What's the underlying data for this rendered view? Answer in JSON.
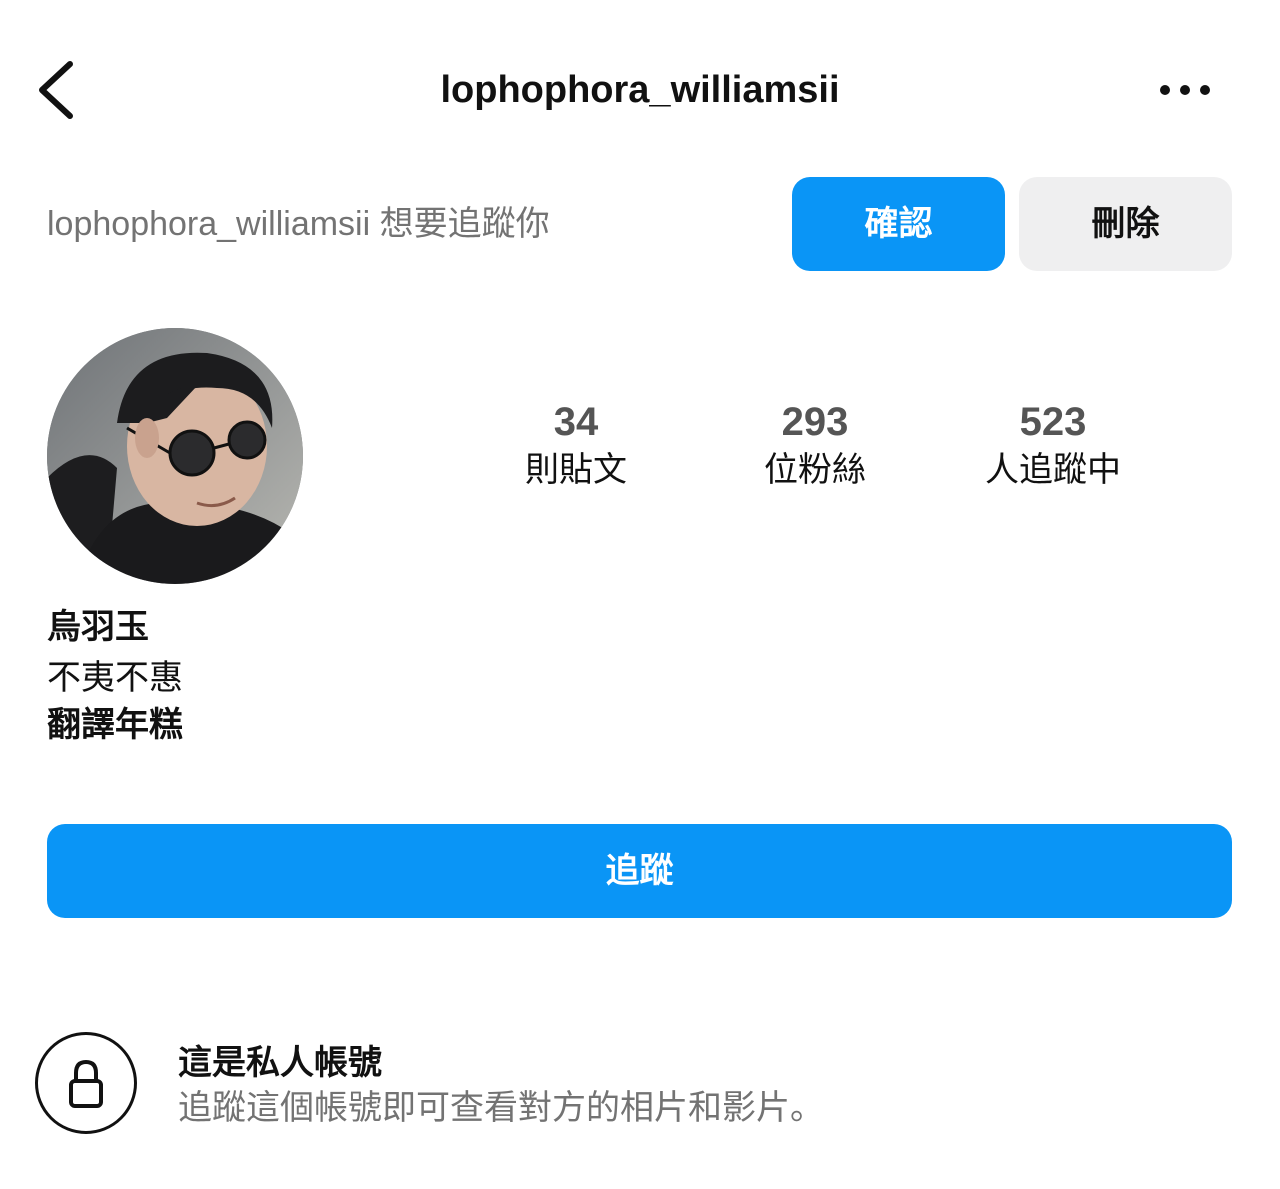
{
  "header": {
    "title": "lophophora_williamsii",
    "back_icon": "chevron-left-icon",
    "more_icon": "more-horizontal-icon"
  },
  "follow_request": {
    "text": "lophophora_williamsii 想要追蹤你",
    "confirm_label": "確認",
    "delete_label": "刪除"
  },
  "profile": {
    "avatar_icon": "profile-photo",
    "stats": [
      {
        "value": "34",
        "label": "則貼文"
      },
      {
        "value": "293",
        "label": "位粉絲"
      },
      {
        "value": "523",
        "label": "人追蹤中"
      }
    ],
    "name": "烏羽玉",
    "bio_line1": "不夷不惠",
    "bio_line2": "翻譯年糕"
  },
  "follow_button": {
    "label": "追蹤"
  },
  "private_notice": {
    "icon": "lock-icon",
    "title": "這是私人帳號",
    "description": "追蹤這個帳號即可查看對方的相片和影片。"
  },
  "colors": {
    "accent": "#0a95f6",
    "secondary_button": "#efeff0",
    "muted_text": "#737373"
  }
}
